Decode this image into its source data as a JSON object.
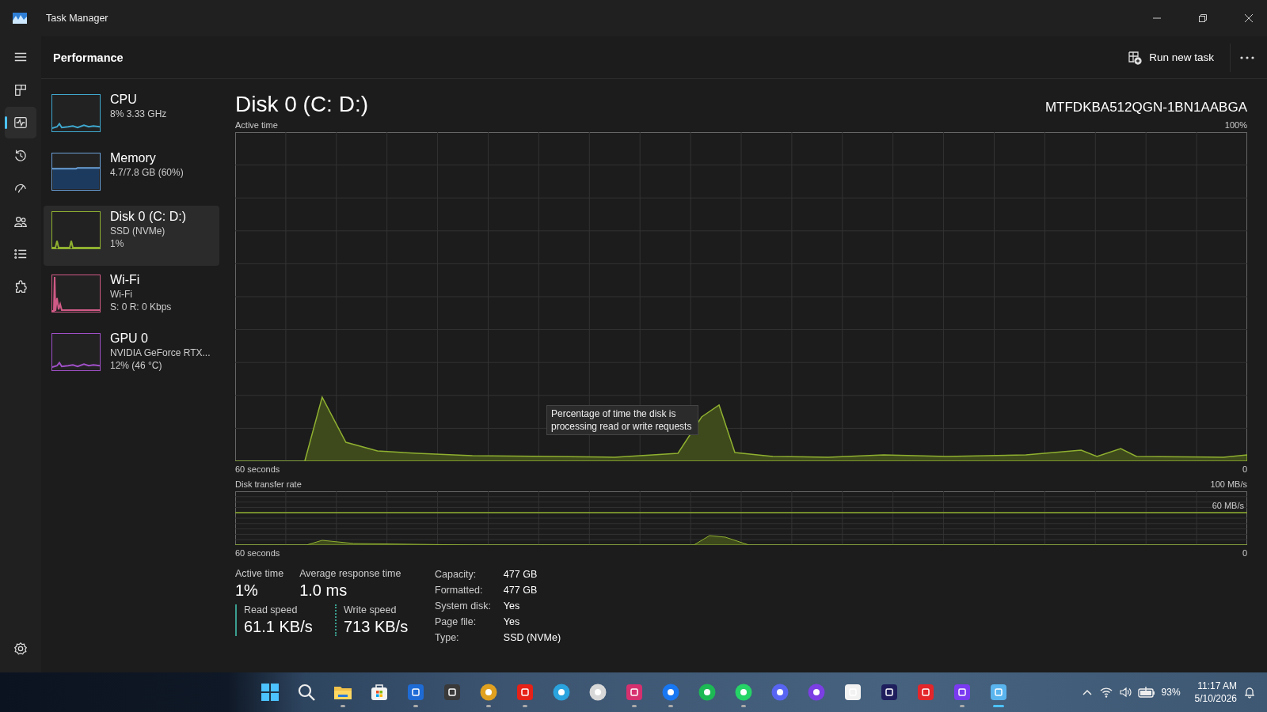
{
  "window": {
    "title": "Task Manager"
  },
  "nav": [
    {
      "kind": "menu",
      "selected": false
    },
    {
      "kind": "processes",
      "selected": false
    },
    {
      "kind": "performance",
      "selected": true
    },
    {
      "kind": "history",
      "selected": false
    },
    {
      "kind": "startup",
      "selected": false
    },
    {
      "kind": "users",
      "selected": false
    },
    {
      "kind": "details",
      "selected": false
    },
    {
      "kind": "services",
      "selected": false
    }
  ],
  "page_title": "Performance",
  "toolbar": {
    "run_new_task": "Run new task"
  },
  "devices": [
    {
      "name": "CPU",
      "lines": [
        "8% 3.33 GHz"
      ],
      "color": "#3fa8cf",
      "kind": "line",
      "selected": false
    },
    {
      "name": "Memory",
      "lines": [
        "4.7/7.8 GB (60%)"
      ],
      "color": "#6aa0d8",
      "kind": "fill",
      "selected": false
    },
    {
      "name": "Disk 0 (C: D:)",
      "lines": [
        "SSD (NVMe)",
        "1%"
      ],
      "color": "#8fb030",
      "kind": "spikes",
      "selected": true
    },
    {
      "name": "Wi-Fi",
      "lines": [
        "Wi-Fi",
        "S: 0 R: 0 Kbps"
      ],
      "color": "#d05a86",
      "kind": "burst",
      "selected": false
    },
    {
      "name": "GPU 0",
      "lines": [
        "NVIDIA GeForce RTX...",
        "12% (46 °C)"
      ],
      "color": "#a050c8",
      "kind": "line",
      "selected": false
    }
  ],
  "detail": {
    "title": "Disk 0 (C: D:)",
    "model": "MTFDKBA512QGN-1BN1AABGA",
    "active_graph": {
      "label": "Active time",
      "max": "100%",
      "time": "60 seconds",
      "min": "0",
      "tooltip": "Percentage of time the disk is processing read or write requests"
    },
    "transfer_graph": {
      "label": "Disk transfer rate",
      "max": "100 MB/s",
      "line_label": "60 MB/s",
      "time": "60 seconds",
      "min": "0"
    },
    "stats": [
      {
        "label": "Active time",
        "value": "1%"
      },
      {
        "label": "Average response time",
        "value": "1.0 ms"
      }
    ],
    "speeds": [
      {
        "label": "Read speed",
        "value": "61.1 KB/s",
        "kind": "solid"
      },
      {
        "label": "Write speed",
        "value": "713 KB/s",
        "kind": "dotted"
      }
    ],
    "properties": [
      {
        "label": "Capacity:",
        "value": "477 GB"
      },
      {
        "label": "Formatted:",
        "value": "477 GB"
      },
      {
        "label": "System disk:",
        "value": "Yes"
      },
      {
        "label": "Page file:",
        "value": "Yes"
      },
      {
        "label": "Type:",
        "value": "SSD (NVMe)"
      }
    ]
  },
  "taskbar": {
    "apps": [
      {
        "kind": "start",
        "running": false,
        "active": false
      },
      {
        "kind": "search",
        "running": false,
        "active": false
      },
      {
        "kind": "folder",
        "running": true,
        "active": false
      },
      {
        "kind": "store",
        "running": false,
        "active": false
      },
      {
        "kind": "square",
        "color": "#1e6bd6",
        "running": true,
        "active": false
      },
      {
        "kind": "square",
        "color": "#3a3a3a",
        "running": false,
        "active": false
      },
      {
        "kind": "circle",
        "color": "#e0a020",
        "running": true,
        "active": false
      },
      {
        "kind": "square",
        "color": "#e62117",
        "running": true,
        "active": false
      },
      {
        "kind": "circle",
        "color": "#2aa3de",
        "running": false,
        "active": false
      },
      {
        "kind": "circle",
        "color": "#d8d8d8",
        "running": false,
        "active": false
      },
      {
        "kind": "square",
        "color": "#d6306f",
        "running": true,
        "active": false
      },
      {
        "kind": "circle",
        "color": "#1877f2",
        "running": true,
        "active": false
      },
      {
        "kind": "circle",
        "color": "#1db954",
        "running": false,
        "active": false
      },
      {
        "kind": "circle",
        "color": "#25d366",
        "running": true,
        "active": false
      },
      {
        "kind": "circle",
        "color": "#5865f2",
        "running": false,
        "active": false
      },
      {
        "kind": "circle",
        "color": "#7b3fe4",
        "running": false,
        "active": false
      },
      {
        "kind": "square",
        "color": "#f2f2f2",
        "running": false,
        "active": false
      },
      {
        "kind": "square",
        "color": "#1f1f5e",
        "running": false,
        "active": false
      },
      {
        "kind": "square",
        "color": "#e3262a",
        "running": false,
        "active": false
      },
      {
        "kind": "square",
        "color": "#7a3af0",
        "running": true,
        "active": false
      },
      {
        "kind": "square",
        "color": "#5ab4ee",
        "running": true,
        "active": true
      }
    ],
    "tray": {
      "battery": "93%",
      "time": "11:17 AM",
      "date": "5/10/2026"
    }
  }
}
